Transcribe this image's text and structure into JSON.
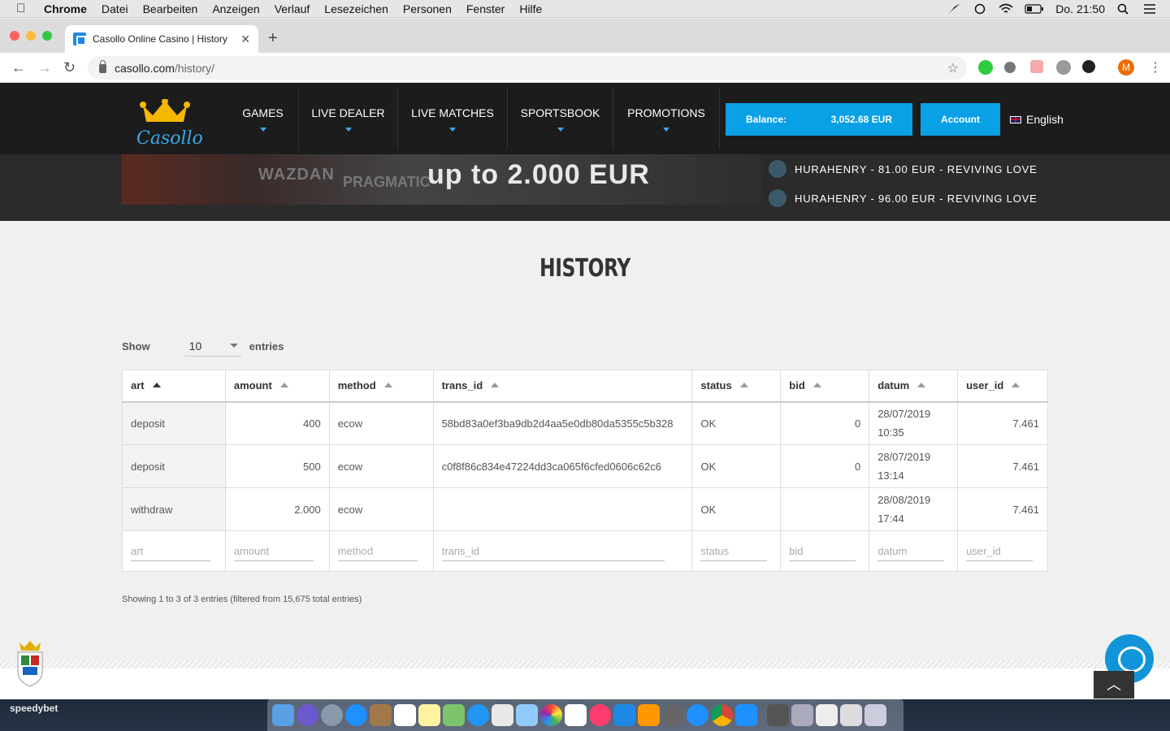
{
  "menubar": {
    "app": "Chrome",
    "items": [
      "Datei",
      "Bearbeiten",
      "Anzeigen",
      "Verlauf",
      "Lesezeichen",
      "Personen",
      "Fenster",
      "Hilfe"
    ],
    "clock": "Do. 21:50"
  },
  "browser": {
    "tab_title": "Casollo Online Casino | History",
    "url_host": "casollo.com",
    "url_path": "/history/",
    "profile_initial": "M"
  },
  "site": {
    "logo_text": "Casollo",
    "nav": [
      "GAMES",
      "LIVE DEALER",
      "LIVE MATCHES",
      "SPORTSBOOK",
      "PROMOTIONS"
    ],
    "balance_label": "Balance:",
    "balance_value": "3,052.68 EUR",
    "account_label": "Account",
    "language": "English"
  },
  "banner": {
    "brand1": "WAZDAN",
    "brand2": "PRAGMATIC",
    "headline": "up to 2.000 EUR",
    "winners": [
      "HURAHENRY - 81.00 EUR - REVIVING LOVE",
      "HURAHENRY - 96.00 EUR - REVIVING LOVE"
    ]
  },
  "history": {
    "title": "HISTORY",
    "show_label": "Show",
    "entries_label": "entries",
    "page_size": "10",
    "columns": [
      "art",
      "amount",
      "method",
      "trans_id",
      "status",
      "bid",
      "datum",
      "user_id"
    ],
    "rows": [
      {
        "art": "deposit",
        "amount": "400",
        "method": "ecow",
        "trans_id": "58bd83a0ef3ba9db2d4aa5e0db80da5355c5b328",
        "status": "OK",
        "bid": "0",
        "datum_date": "28/07/2019",
        "datum_time": "10:35",
        "user_id": "7.461"
      },
      {
        "art": "deposit",
        "amount": "500",
        "method": "ecow",
        "trans_id": "c0f8f86c834e47224dd3ca065f6cfed0606c62c6",
        "status": "OK",
        "bid": "0",
        "datum_date": "28/07/2019",
        "datum_time": "13:14",
        "user_id": "7.461"
      },
      {
        "art": "withdraw",
        "amount": "2.000",
        "method": "ecow",
        "trans_id": "",
        "status": "OK",
        "bid": "",
        "datum_date": "28/08/2019",
        "datum_time": "17:44",
        "user_id": "7.461"
      }
    ],
    "filter_placeholders": [
      "art",
      "amount",
      "method",
      "trans_id",
      "status",
      "bid",
      "datum",
      "user_id"
    ],
    "info": "Showing 1 to 3 of 3 entries (filtered from 15,675 total entries)"
  },
  "desktop": {
    "label": "speedybet"
  },
  "colors": {
    "accent": "#0aa0e6",
    "header_bg": "#1c1c1c",
    "logo_gold": "#f5b800"
  }
}
